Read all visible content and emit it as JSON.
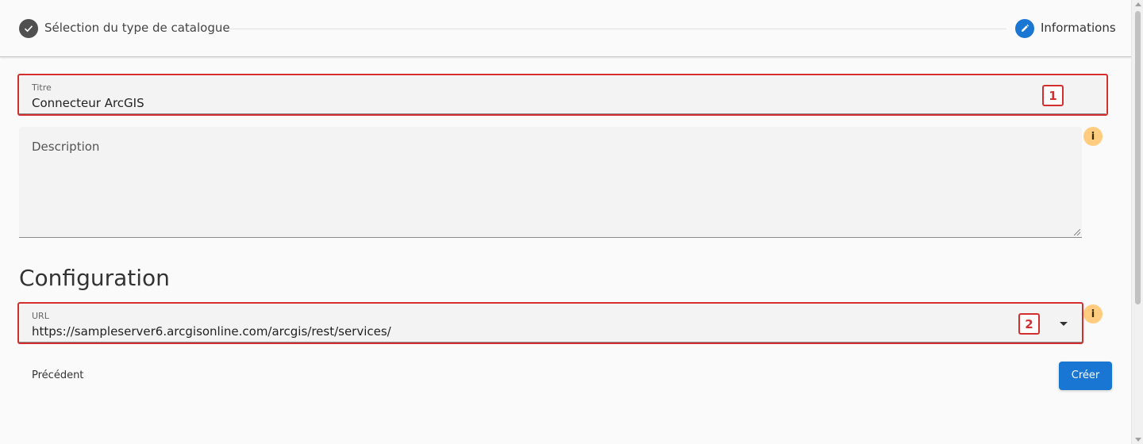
{
  "stepper": {
    "step1": {
      "label": "Sélection du type de catalogue",
      "icon": "check-icon",
      "state": "completed"
    },
    "step2": {
      "label": "Informations",
      "icon": "pencil-icon",
      "state": "active"
    },
    "colors": {
      "completed": "#505050",
      "active": "#1976d2"
    }
  },
  "form": {
    "titre": {
      "label": "Titre",
      "value": "Connecteur ArcGIS"
    },
    "description": {
      "placeholder": "Description",
      "value": ""
    },
    "configuration": {
      "title": "Configuration",
      "url": {
        "label": "URL",
        "value": "https://sampleserver6.arcgisonline.com/arcgis/rest/services/"
      }
    },
    "info_icon": "i"
  },
  "annotations": {
    "badge1": "1",
    "badge2": "2",
    "color": "#d32f2f"
  },
  "actions": {
    "previous_label": "Précédent",
    "create_label": "Créer"
  }
}
